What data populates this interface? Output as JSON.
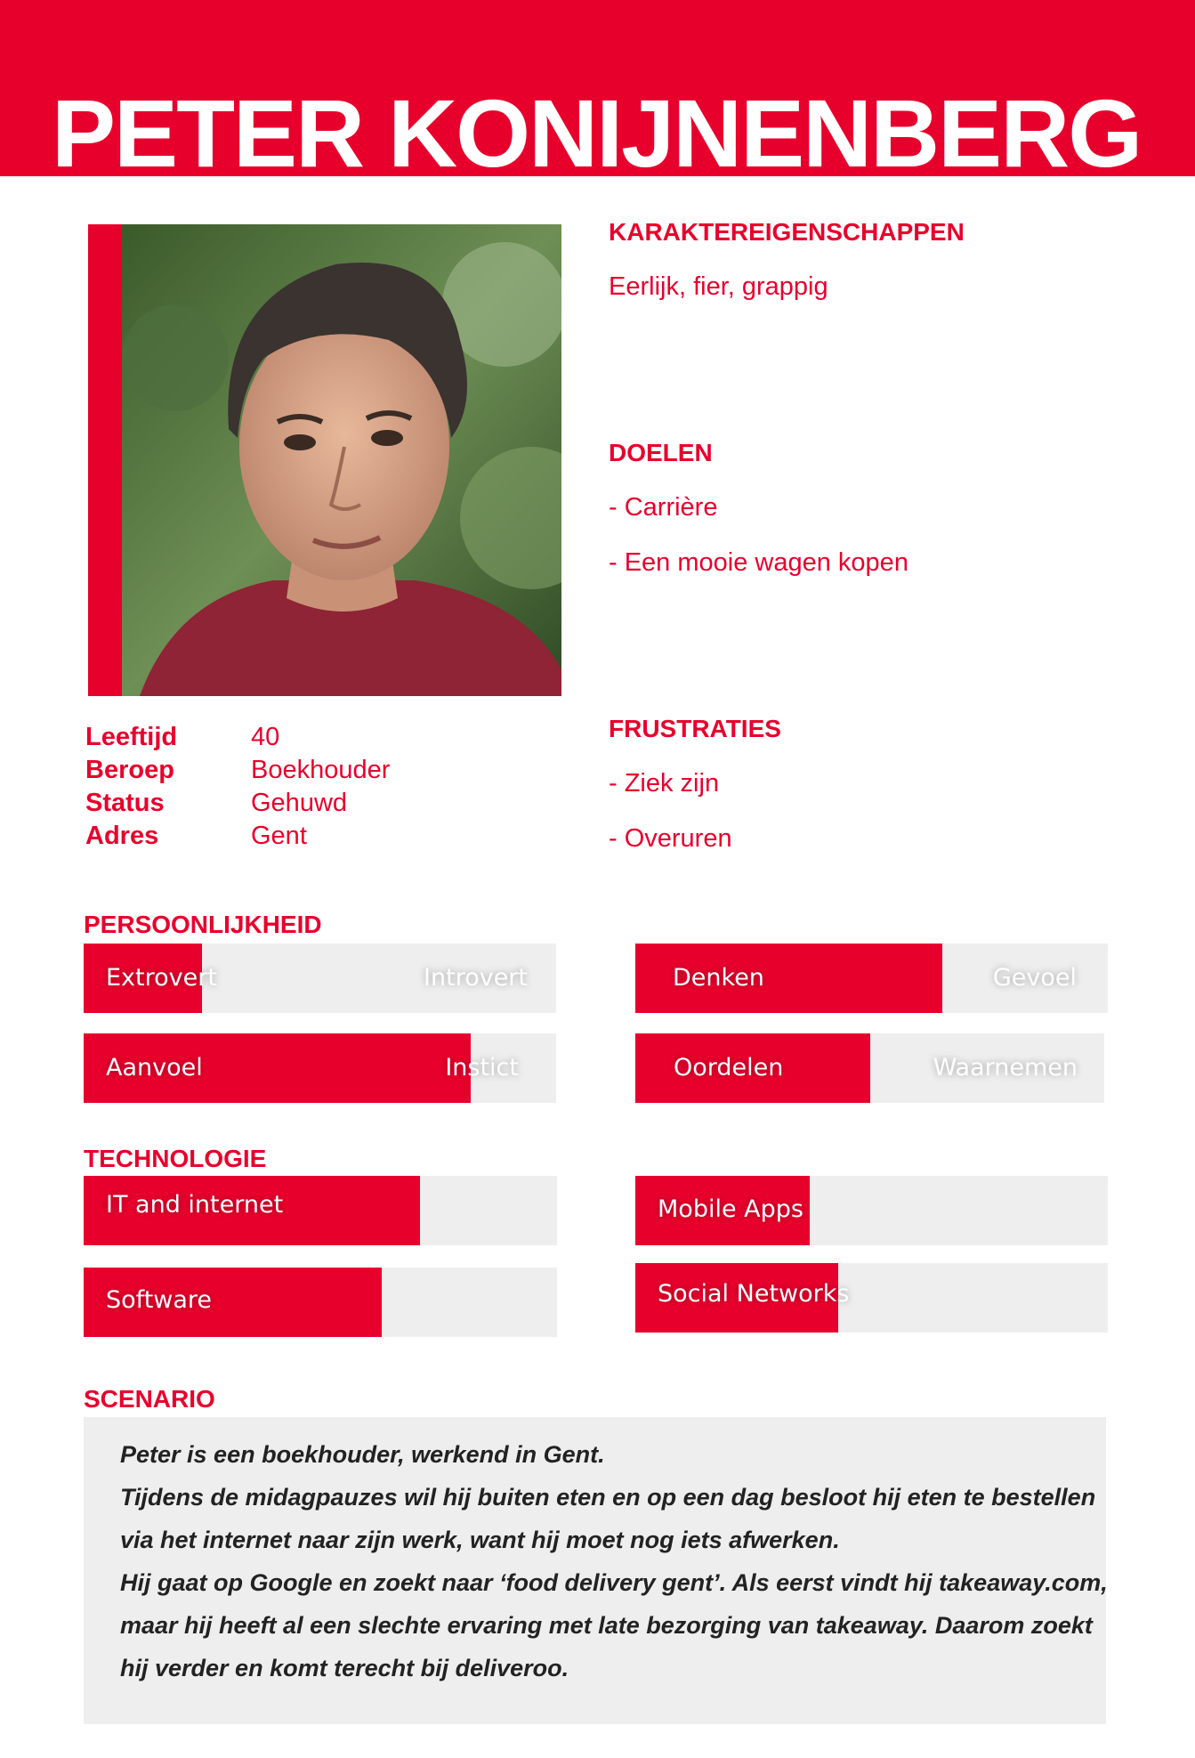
{
  "header": {
    "name": "PETER KONIJNENBERG"
  },
  "photo": {
    "alt": "portrait"
  },
  "traits": {
    "title": "KARAKTEREIGENSCHAPPEN",
    "text": "Eerlijk, fier, grappig"
  },
  "goals": {
    "title": "DOELEN",
    "items": [
      "- Carrière",
      "- Een mooie wagen kopen"
    ]
  },
  "frustrations": {
    "title": "FRUSTRATIES",
    "items": [
      "- Ziek zijn",
      "- Overuren"
    ]
  },
  "info": [
    {
      "label": "Leeftijd",
      "value": "40"
    },
    {
      "label": "Beroep",
      "value": "Boekhouder"
    },
    {
      "label": "Status",
      "value": "Gehuwd"
    },
    {
      "label": "Adres",
      "value": "Gent"
    }
  ],
  "personality": {
    "title": "PERSOONLIJKHEID",
    "bars": [
      {
        "left": "Extrovert",
        "right": "Introvert",
        "level": 0.25
      },
      {
        "left": "Denken",
        "right": "Gevoel",
        "level": 0.65
      },
      {
        "left": "Aanvoel",
        "right": "Instict",
        "level": 0.82
      },
      {
        "left": "Oordelen",
        "right": "Waarnemen",
        "level": 0.5
      }
    ]
  },
  "technology": {
    "title": "TECHNOLOGIE",
    "bars": [
      {
        "label": "IT and internet",
        "level": 0.71
      },
      {
        "label": "Mobile Apps",
        "level": 0.37
      },
      {
        "label": "Software",
        "level": 0.63
      },
      {
        "label": "Social Networks",
        "level": 0.43
      }
    ]
  },
  "scenario": {
    "title": "SCENARIO",
    "lines": [
      "Peter is een boekhouder, werkend in Gent.",
      "Tijdens de midagpauzes wil hij buiten eten en op een dag besloot hij eten te bestellen",
      "via het internet naar zijn werk, want hij moet nog iets afwerken.",
      "Hij gaat op Google en zoekt naar ‘food delivery gent’. Als eerst vindt hij takeaway.com,",
      "maar hij heeft al een slechte ervaring met late bezorging van takeaway. Daarom zoekt",
      "hij verder en komt terecht bij deliveroo."
    ]
  },
  "colors": {
    "accent": "#e8002c",
    "bar_bg": "#eeeeee",
    "text_dark": "#222222"
  }
}
